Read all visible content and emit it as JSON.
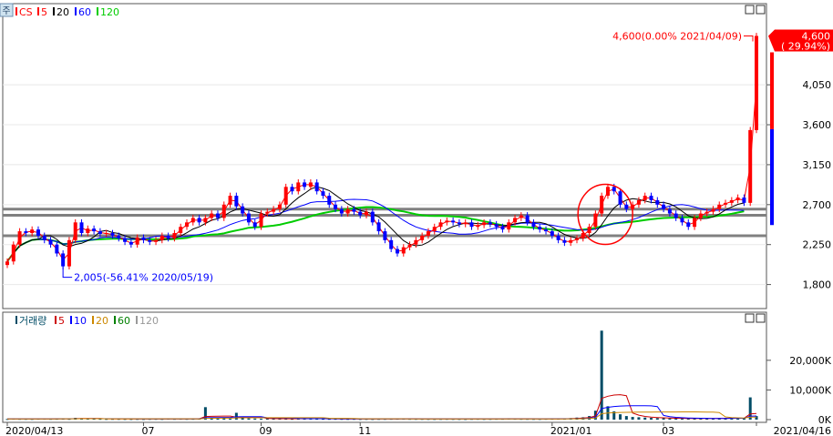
{
  "colors": {
    "up": "#ff0000",
    "down": "#0000ff",
    "ma5": "#ff0000",
    "ma20": "#000000",
    "ma60": "#0000ff",
    "ma120": "#00cc00",
    "vma5": "#cc0000",
    "vma10": "#0000ff",
    "vma20": "#cc8800",
    "vma60": "#008000",
    "vma120": "#999999",
    "volume": "#004c66",
    "marker": "#ff0000"
  },
  "price_legend": {
    "badge": "주",
    "items": [
      {
        "label": "CS",
        "color": "#ff0000"
      },
      {
        "label": "5",
        "color": "#ff0000"
      },
      {
        "label": "20",
        "color": "#000000"
      },
      {
        "label": "60",
        "color": "#0000ff"
      },
      {
        "label": "120",
        "color": "#00cc00"
      }
    ]
  },
  "volume_legend": {
    "items": [
      {
        "label": "거래량",
        "color": "#004c66"
      },
      {
        "label": "5",
        "color": "#cc0000"
      },
      {
        "label": "10",
        "color": "#0000ff"
      },
      {
        "label": "20",
        "color": "#cc8800"
      },
      {
        "label": "60",
        "color": "#008000"
      },
      {
        "label": "120",
        "color": "#999999"
      }
    ]
  },
  "chart_data": [
    {
      "type": "candlestick",
      "panel": "price",
      "y_ticks": [
        1800,
        2250,
        2700,
        3150,
        3600,
        4050
      ],
      "y_tick_labels": [
        "1,800",
        "2,250",
        "2,700",
        "3,150",
        "3,600",
        "4,050"
      ],
      "ylim": [
        1560,
        4800
      ],
      "support_lines": [
        2350,
        2580,
        2650
      ],
      "annotations": {
        "high": {
          "text": "4,600(0.00% 2021/04/09)",
          "value": 4600
        },
        "low": {
          "text": "2,005(-56.41% 2020/05/19)",
          "value": 2005
        },
        "current_price": "4,600",
        "current_change": "( 29.94%)"
      },
      "series": [
        {
          "name": "CS",
          "values": [
            2060,
            2250,
            2400,
            2380,
            2420,
            2350,
            2300,
            2250,
            2150,
            2005,
            2300,
            2500,
            2380,
            2430,
            2400,
            2370,
            2380,
            2350,
            2320,
            2280,
            2250,
            2330,
            2300,
            2280,
            2300,
            2350,
            2320,
            2380,
            2450,
            2500,
            2550,
            2500,
            2550,
            2600,
            2550,
            2700,
            2800,
            2680,
            2600,
            2500,
            2450,
            2600,
            2620,
            2650,
            2700,
            2900,
            2850,
            2950,
            2900,
            2950,
            2850,
            2800,
            2700,
            2650,
            2600,
            2650,
            2620,
            2580,
            2620,
            2500,
            2400,
            2300,
            2200,
            2150,
            2220,
            2250,
            2300,
            2350,
            2400,
            2450,
            2500,
            2520,
            2500,
            2480,
            2500,
            2450,
            2470,
            2500,
            2480,
            2450,
            2420,
            2500,
            2550,
            2580,
            2500,
            2450,
            2420,
            2400,
            2350,
            2300,
            2270,
            2300,
            2320,
            2380,
            2450,
            2600,
            2800,
            2900,
            2850,
            2700,
            2650,
            2700,
            2750,
            2800,
            2750,
            2700,
            2650,
            2600,
            2550,
            2500,
            2450,
            2550,
            2600,
            2620,
            2650,
            2700,
            2720,
            2750,
            2780,
            2720,
            3540,
            4600
          ]
        }
      ]
    },
    {
      "type": "bar",
      "panel": "volume",
      "y_ticks": [
        0,
        10000,
        20000
      ],
      "y_tick_labels": [
        "0K",
        "10,000K",
        "20,000K"
      ],
      "ylim": [
        0,
        31000
      ],
      "series": [
        {
          "name": "거래량",
          "values": [
            210,
            300,
            250,
            240,
            220,
            280,
            300,
            250,
            270,
            320,
            240,
            600,
            400,
            300,
            280,
            250,
            220,
            240,
            230,
            210,
            200,
            220,
            210,
            230,
            240,
            220,
            300,
            250,
            280,
            240,
            260,
            300,
            4200,
            600,
            400,
            500,
            300,
            2300,
            700,
            400,
            350,
            300,
            280,
            300,
            320,
            300,
            250,
            400,
            350,
            300,
            280,
            260,
            240,
            250,
            230,
            220,
            240,
            210,
            220,
            200,
            230,
            240,
            260,
            280,
            300,
            250,
            240,
            230,
            220,
            210,
            230,
            240,
            220,
            210,
            200,
            240,
            250,
            220,
            230,
            260,
            270,
            350,
            280,
            250,
            240,
            230,
            220,
            260,
            280,
            300,
            300,
            500,
            700,
            800,
            1200,
            3000,
            30000,
            4500,
            2800,
            1800,
            1200,
            900,
            800,
            700,
            600,
            500,
            450,
            400,
            420,
            380,
            360,
            400,
            380,
            400,
            420,
            500,
            450,
            480,
            500,
            600,
            7500,
            1200
          ]
        }
      ]
    }
  ],
  "x_axis": {
    "labels": [
      "2020/04/13",
      "07",
      "09",
      "11",
      "2021/01",
      "03",
      "2021/04/16"
    ]
  }
}
